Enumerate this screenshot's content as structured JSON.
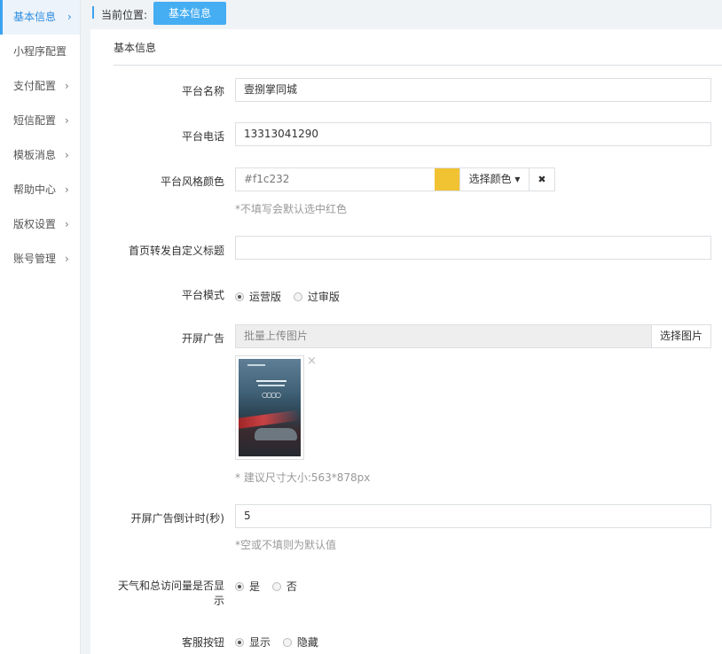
{
  "sidebar": {
    "items": [
      {
        "label": "基本信息",
        "chevron": "›",
        "active": true
      },
      {
        "label": "小程序配置",
        "chevron": ""
      },
      {
        "label": "支付配置",
        "chevron": "›"
      },
      {
        "label": "短信配置",
        "chevron": "›"
      },
      {
        "label": "模板消息",
        "chevron": "›"
      },
      {
        "label": "帮助中心",
        "chevron": "›"
      },
      {
        "label": "版权设置",
        "chevron": "›"
      },
      {
        "label": "账号管理",
        "chevron": "›"
      }
    ]
  },
  "topbar": {
    "location_label": "当前位置:",
    "crumb": "基本信息"
  },
  "main": {
    "section_title": "基本信息",
    "platform_name": {
      "label": "平台名称",
      "value": "壹捌掌同城"
    },
    "platform_phone": {
      "label": "平台电话",
      "value": "13313041290"
    },
    "style_color": {
      "label": "平台风格颜色",
      "value": "#f1c232",
      "pick_button": "选择颜色 ▾",
      "clear_button": "✖",
      "hint": "*不填写会默认选中红色",
      "swatch_color": "#f1c232"
    },
    "share_title": {
      "label": "首页转发自定义标题",
      "value": ""
    },
    "platform_mode": {
      "label": "平台模式",
      "options": [
        "运营版",
        "过审版"
      ],
      "selected": "运营版"
    },
    "splash_ad": {
      "label": "开屏广告",
      "placeholder": "批量上传图片",
      "pick_button": "选择图片",
      "remove_icon": "×",
      "hint": "* 建议尺寸大小:563*878px"
    },
    "countdown": {
      "label": "开屏广告倒计时(秒)",
      "value": "5",
      "hint": "*空或不填则为默认值"
    },
    "weather_display": {
      "label_line1": "天气和总访问量是否显",
      "label_line2": "示",
      "options": [
        "是",
        "否"
      ],
      "selected": "是"
    },
    "service_button": {
      "label": "客服按钮",
      "options": [
        "显示",
        "隐藏"
      ],
      "selected": "显示"
    }
  }
}
